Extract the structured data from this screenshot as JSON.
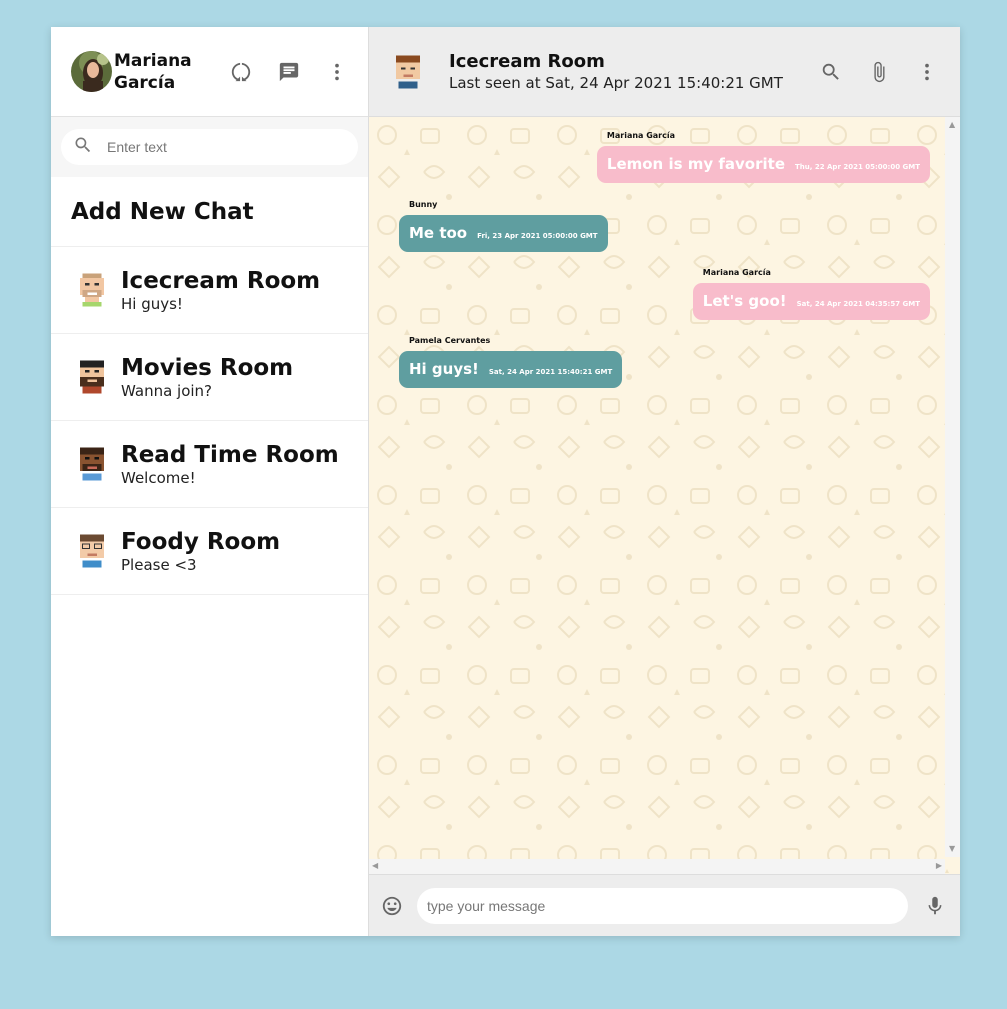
{
  "user": {
    "name_line1": "Mariana",
    "name_line2": "García"
  },
  "sidebar": {
    "search_placeholder": "Enter text",
    "add_chat_label": "Add New Chat",
    "rooms": [
      {
        "name": "Icecream Room",
        "last": "Hi guys!"
      },
      {
        "name": "Movies Room",
        "last": "Wanna join?"
      },
      {
        "name": "Read Time Room",
        "last": "Welcome!"
      },
      {
        "name": "Foody Room",
        "last": "Please <3"
      }
    ]
  },
  "chat": {
    "title": "Icecream Room",
    "last_seen": "Last seen at Sat, 24 Apr 2021 15:40:21 GMT",
    "messages": [
      {
        "sender": "Mariana García",
        "text": "Lemon is my favorite",
        "time": "Thu, 22 Apr 2021 05:00:00 GMT",
        "mine": true
      },
      {
        "sender": "Bunny",
        "text": "Me too",
        "time": "Fri, 23 Apr 2021 05:00:00 GMT",
        "mine": false
      },
      {
        "sender": "Mariana García",
        "text": "Let's goo!",
        "time": "Sat, 24 Apr 2021 04:35:57 GMT",
        "mine": true
      },
      {
        "sender": "Pamela Cervantes",
        "text": "Hi guys!",
        "time": "Sat, 24 Apr 2021 15:40:21 GMT",
        "mine": false
      }
    ],
    "input_placeholder": "type your message"
  },
  "colors": {
    "background": "#acd8e5",
    "chat_bg": "#fdf5e2",
    "my_bubble": "#f8bccb",
    "their_bubble": "#5f9ea0",
    "header_bg": "#ededed"
  },
  "icons": [
    "status-icon",
    "new-chat-icon",
    "more-vert-icon",
    "search-icon",
    "attach-icon",
    "emoji-icon",
    "mic-icon"
  ]
}
